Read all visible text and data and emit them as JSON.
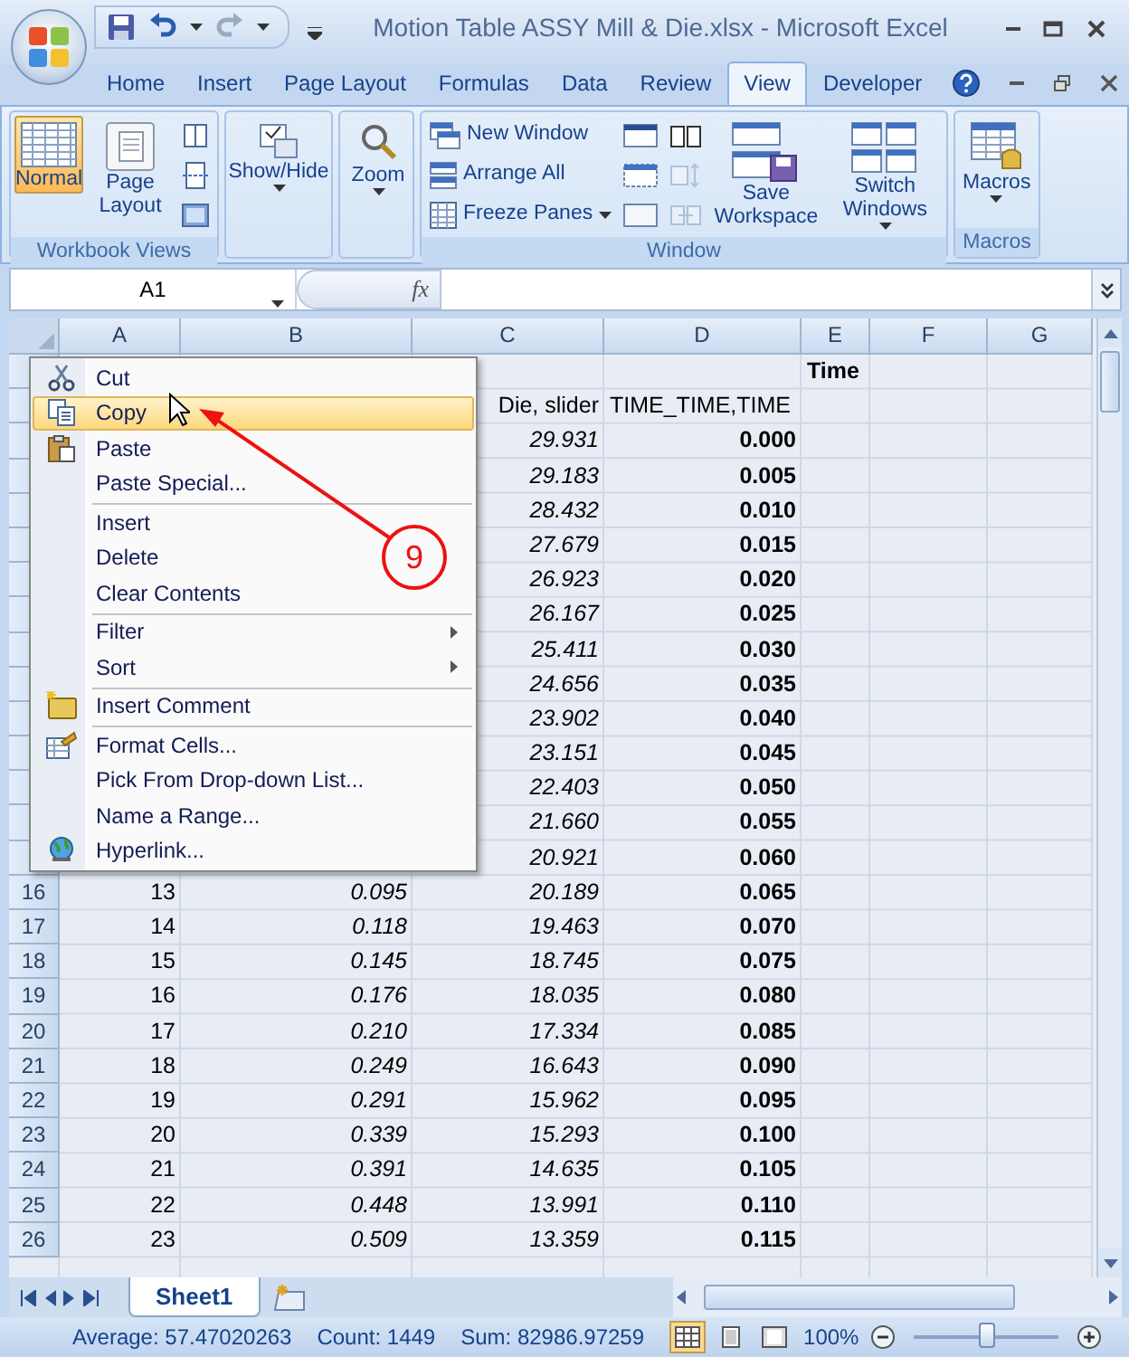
{
  "window": {
    "title": "Motion Table ASSY Mill & Die.xlsx - Microsoft Excel"
  },
  "ribbon_tabs": [
    {
      "label": "Home",
      "selected": false
    },
    {
      "label": "Insert",
      "selected": false
    },
    {
      "label": "Page Layout",
      "selected": false
    },
    {
      "label": "Formulas",
      "selected": false
    },
    {
      "label": "Data",
      "selected": false
    },
    {
      "label": "Review",
      "selected": false
    },
    {
      "label": "View",
      "selected": true
    },
    {
      "label": "Developer",
      "selected": false
    }
  ],
  "ribbon_groups": [
    {
      "label": "Workbook Views",
      "controls": [
        {
          "kind": "large",
          "label": "Normal",
          "selected": true
        },
        {
          "kind": "large",
          "label": "Page Layout",
          "selected": false
        },
        {
          "kind": "stack",
          "items": [
            {
              "kind": "icon"
            },
            {
              "kind": "icon"
            },
            {
              "kind": "icon"
            }
          ]
        }
      ]
    },
    {
      "controls": [
        {
          "kind": "large",
          "label": "Show/Hide",
          "dropdown": true
        }
      ]
    },
    {
      "controls": [
        {
          "kind": "large",
          "label": "Zoom",
          "dropdown": true
        }
      ]
    },
    {
      "label": "Window",
      "controls": [
        {
          "kind": "stack",
          "items": [
            {
              "kind": "small",
              "label": "New Window"
            },
            {
              "kind": "small",
              "label": "Arrange All"
            },
            {
              "kind": "small",
              "label": "Freeze Panes",
              "dropdown": true
            }
          ]
        },
        {
          "kind": "stack",
          "items": [
            {
              "kind": "icon"
            },
            {
              "kind": "icon"
            },
            {
              "kind": "icon"
            }
          ]
        },
        {
          "kind": "stack",
          "items": [
            {
              "kind": "icon",
              "disabled": false
            },
            {
              "kind": "icon",
              "disabled": true
            },
            {
              "kind": "icon",
              "disabled": true
            }
          ]
        },
        {
          "kind": "large",
          "label": "Save Workspace"
        },
        {
          "kind": "large",
          "label": "Switch Windows",
          "dropdown": true
        }
      ]
    },
    {
      "label": "Macros",
      "controls": [
        {
          "kind": "large",
          "label": "Macros",
          "dropdown": true
        }
      ]
    }
  ],
  "formula_bar": {
    "name_box": "A1",
    "function_button": "fx"
  },
  "columns": [
    "A",
    "B",
    "C",
    "D",
    "E",
    "F",
    "G"
  ],
  "rows": [
    {
      "kind": "title",
      "cells": {
        "E": "Time"
      }
    },
    {
      "kind": "header",
      "cells": {
        "C": "Die, slider",
        "D": "TIME_TIME,TIME"
      }
    },
    {
      "kind": "data",
      "cells": {
        "C": "29.931",
        "D": "0.000"
      }
    },
    {
      "kind": "data",
      "cells": {
        "C": "29.183",
        "D": "0.005"
      }
    },
    {
      "kind": "data",
      "cells": {
        "C": "28.432",
        "D": "0.010"
      }
    },
    {
      "kind": "data",
      "cells": {
        "C": "27.679",
        "D": "0.015"
      }
    },
    {
      "kind": "data",
      "cells": {
        "C": "26.923",
        "D": "0.020"
      }
    },
    {
      "kind": "data",
      "cells": {
        "C": "26.167",
        "D": "0.025"
      }
    },
    {
      "kind": "data",
      "cells": {
        "C": "25.411",
        "D": "0.030"
      }
    },
    {
      "kind": "data",
      "cells": {
        "C": "24.656",
        "D": "0.035"
      }
    },
    {
      "kind": "data",
      "cells": {
        "C": "23.902",
        "D": "0.040"
      }
    },
    {
      "kind": "data",
      "cells": {
        "C": "23.151",
        "D": "0.045"
      }
    },
    {
      "kind": "data",
      "cells": {
        "C": "22.403",
        "D": "0.050"
      }
    },
    {
      "kind": "data",
      "cells": {
        "C": "21.660",
        "D": "0.055"
      }
    },
    {
      "kind": "data",
      "cells": {
        "C": "20.921",
        "D": "0.060"
      }
    },
    {
      "kind": "data",
      "row_number": "16",
      "cells": {
        "A": "13",
        "B": "0.095",
        "C": "20.189",
        "D": "0.065"
      }
    },
    {
      "kind": "data",
      "row_number": "17",
      "cells": {
        "A": "14",
        "B": "0.118",
        "C": "19.463",
        "D": "0.070"
      }
    },
    {
      "kind": "data",
      "row_number": "18",
      "cells": {
        "A": "15",
        "B": "0.145",
        "C": "18.745",
        "D": "0.075"
      }
    },
    {
      "kind": "data",
      "row_number": "19",
      "cells": {
        "A": "16",
        "B": "0.176",
        "C": "18.035",
        "D": "0.080"
      }
    },
    {
      "kind": "data",
      "row_number": "20",
      "cells": {
        "A": "17",
        "B": "0.210",
        "C": "17.334",
        "D": "0.085"
      }
    },
    {
      "kind": "data",
      "row_number": "21",
      "cells": {
        "A": "18",
        "B": "0.249",
        "C": "16.643",
        "D": "0.090"
      }
    },
    {
      "kind": "data",
      "row_number": "22",
      "cells": {
        "A": "19",
        "B": "0.291",
        "C": "15.962",
        "D": "0.095"
      }
    },
    {
      "kind": "data",
      "row_number": "23",
      "cells": {
        "A": "20",
        "B": "0.339",
        "C": "15.293",
        "D": "0.100"
      }
    },
    {
      "kind": "data",
      "row_number": "24",
      "cells": {
        "A": "21",
        "B": "0.391",
        "C": "14.635",
        "D": "0.105"
      }
    },
    {
      "kind": "data",
      "row_number": "25",
      "cells": {
        "A": "22",
        "B": "0.448",
        "C": "13.991",
        "D": "0.110"
      }
    },
    {
      "kind": "data",
      "row_number": "26",
      "cells": {
        "A": "23",
        "B": "0.509",
        "C": "13.359",
        "D": "0.115"
      }
    }
  ],
  "context_menu": [
    {
      "label": "Cut",
      "selected": false,
      "submenu": false,
      "separator_before": false
    },
    {
      "label": "Copy",
      "selected": true,
      "submenu": false,
      "separator_before": false
    },
    {
      "label": "Paste",
      "selected": false,
      "submenu": false,
      "separator_before": false
    },
    {
      "label": "Paste Special...",
      "selected": false,
      "submenu": false,
      "separator_before": false
    },
    {
      "label": "Insert",
      "selected": false,
      "submenu": false,
      "separator_before": true
    },
    {
      "label": "Delete",
      "selected": false,
      "submenu": false,
      "separator_before": false
    },
    {
      "label": "Clear Contents",
      "selected": false,
      "submenu": false,
      "separator_before": false
    },
    {
      "label": "Filter",
      "selected": false,
      "submenu": true,
      "separator_before": true
    },
    {
      "label": "Sort",
      "selected": false,
      "submenu": true,
      "separator_before": false
    },
    {
      "label": "Insert Comment",
      "selected": false,
      "submenu": false,
      "separator_before": true
    },
    {
      "label": "Format Cells...",
      "selected": false,
      "submenu": false,
      "separator_before": true
    },
    {
      "label": "Pick From Drop-down List...",
      "selected": false,
      "submenu": false,
      "separator_before": false
    },
    {
      "label": "Name a Range...",
      "selected": false,
      "submenu": false,
      "separator_before": false
    },
    {
      "label": "Hyperlink...",
      "selected": false,
      "submenu": false,
      "separator_before": false
    }
  ],
  "annotation": {
    "label": "9"
  },
  "sheet_tabs": [
    {
      "label": "Sheet1",
      "selected": true
    }
  ],
  "status_bar": {
    "average": "Average: 57.47020263",
    "count": "Count: 1449",
    "sum": "Sum: 82986.97259",
    "views": [
      {
        "selected": true
      },
      {
        "selected": false
      },
      {
        "selected": false
      }
    ],
    "zoom": "100%",
    "zoom_slider": {
      "level": 0.5
    }
  }
}
